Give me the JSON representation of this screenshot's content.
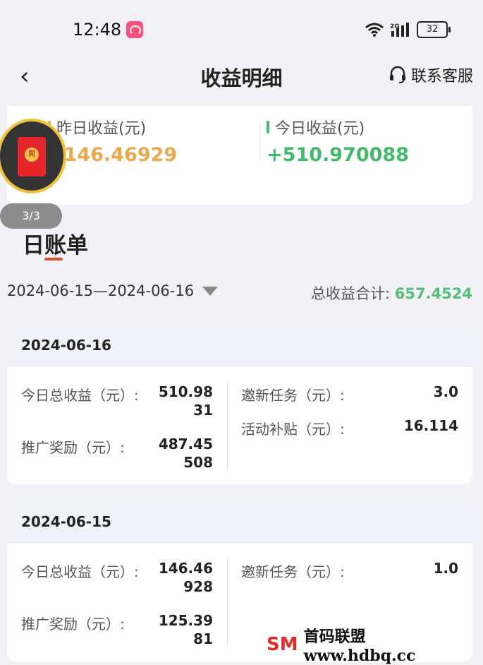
{
  "status": {
    "time": "12:48",
    "network": "2G",
    "battery": "32"
  },
  "nav": {
    "back_icon": "‹",
    "title": "收益明细",
    "support_label": "联系客服"
  },
  "summary": {
    "yesterday_label": "昨日收益(元)",
    "yesterday_value": "+146.46929",
    "today_label": "今日收益(元)",
    "today_value": "+510.970088"
  },
  "floating": {
    "redpack_char": "開",
    "counter": "3/3"
  },
  "section": {
    "title": "日账单"
  },
  "filter": {
    "date_range": "2024-06-15—2024-06-16",
    "total_label": "总收益合计:",
    "total_value": "657.4524"
  },
  "days": [
    {
      "date": "2024-06-16",
      "total_label": "今日总收益（元）:",
      "total_value_1": "510.98",
      "total_value_2": "31",
      "promo_label": "推广奖励（元）:",
      "promo_value_1": "487.45",
      "promo_value_2": "508",
      "invite_label": "邀新任务（元）:",
      "invite_value": "3.0",
      "subsidy_label": "活动补贴（元）:",
      "subsidy_value": "16.114"
    },
    {
      "date": "2024-06-15",
      "total_label": "今日总收益（元）:",
      "total_value_1": "146.46",
      "total_value_2": "928",
      "promo_label": "推广奖励（元）:",
      "promo_value_1": "125.39",
      "promo_value_2": "81",
      "invite_label": "邀新任务（元）:",
      "invite_value": "1.0"
    }
  ],
  "watermark": {
    "logo": "SM",
    "text": "首码联盟 www.hdbq.cc"
  },
  "colors": {
    "yesterday": "#e9a94c",
    "today": "#44b96b",
    "accent": "#e14d2a"
  }
}
